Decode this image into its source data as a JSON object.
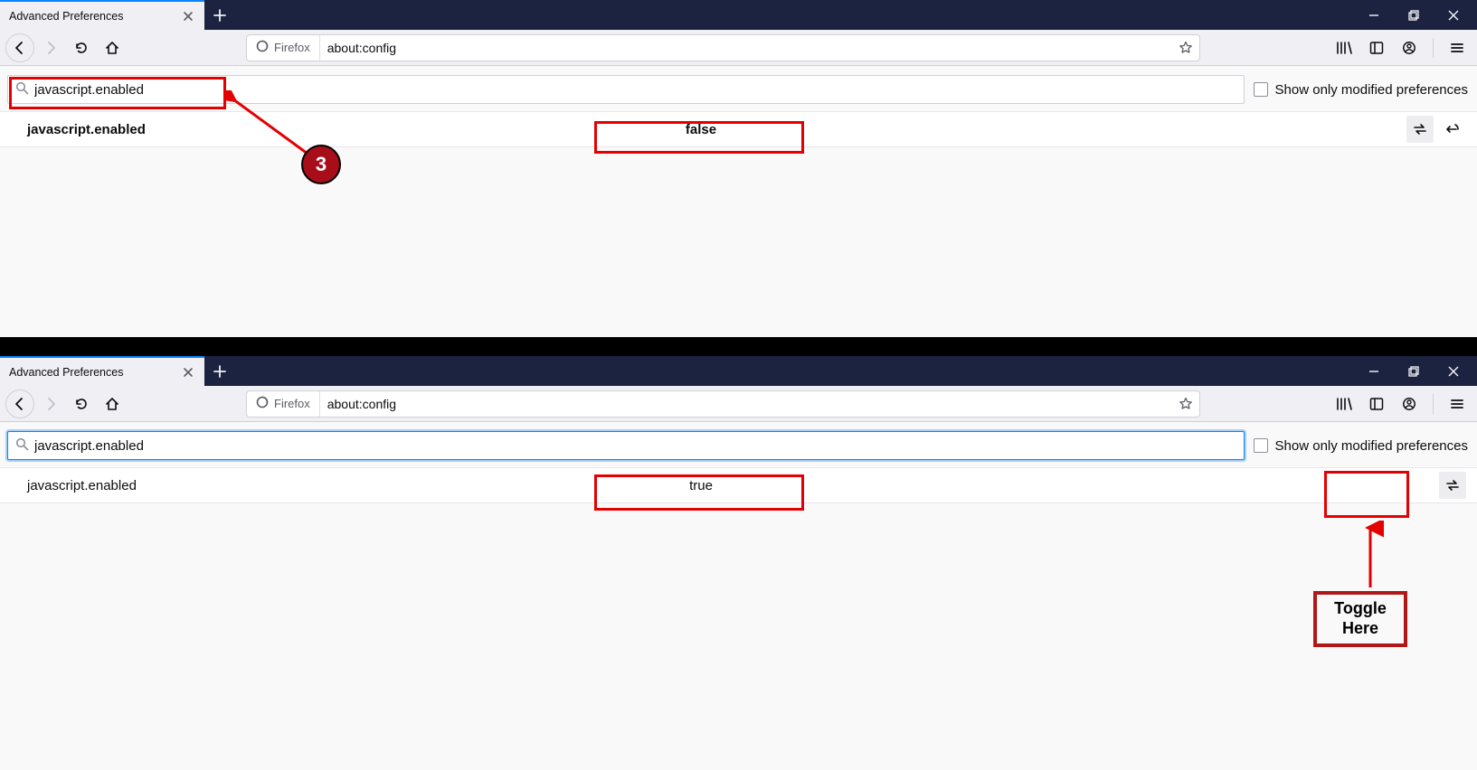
{
  "window1": {
    "tab": {
      "title": "Advanced Preferences"
    },
    "urlbar": {
      "identity": "Firefox",
      "url": "about:config"
    },
    "search": {
      "value": "javascript.enabled"
    },
    "only_modified_label": "Show only modified preferences",
    "pref": {
      "name": "javascript.enabled",
      "value": "false"
    },
    "step_label": "3"
  },
  "window2": {
    "tab": {
      "title": "Advanced Preferences"
    },
    "urlbar": {
      "identity": "Firefox",
      "url": "about:config"
    },
    "search": {
      "value": "javascript.enabled"
    },
    "only_modified_label": "Show only modified preferences",
    "pref": {
      "name": "javascript.enabled",
      "value": "true"
    },
    "toggle_hint": "Toggle Here"
  }
}
